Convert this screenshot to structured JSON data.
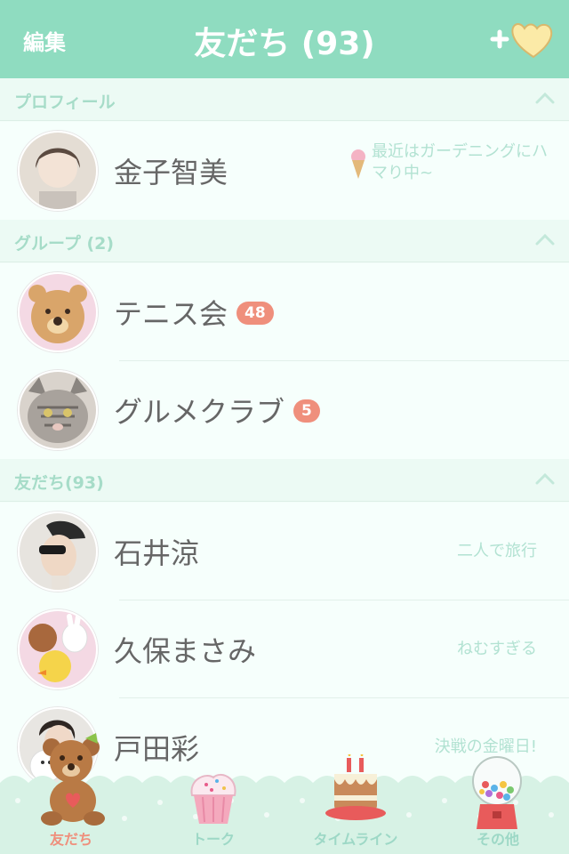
{
  "header": {
    "edit": "編集",
    "title": "友だち (93)"
  },
  "sections": {
    "profile": "プロフィール",
    "groups": "グループ (2)",
    "friends": "友だち(93)"
  },
  "profile": {
    "name": "金子智美",
    "status": "最近はガーデニングにハマり中~"
  },
  "groups": [
    {
      "name": "テニス会",
      "badge": "48"
    },
    {
      "name": "グルメクラブ",
      "badge": "5"
    }
  ],
  "friends": [
    {
      "name": "石井涼",
      "status": "二人で旅行"
    },
    {
      "name": "久保まさみ",
      "status": "ねむすぎる"
    },
    {
      "name": "戸田彩",
      "status": "決戦の金曜日!"
    }
  ],
  "tabs": [
    {
      "label": "友だち",
      "icon": "teddy-bear-icon",
      "active": true
    },
    {
      "label": "トーク",
      "icon": "cupcake-icon",
      "active": false
    },
    {
      "label": "タイムライン",
      "icon": "birthday-cake-icon",
      "active": false
    },
    {
      "label": "その他",
      "icon": "gumball-machine-icon",
      "active": false
    }
  ],
  "colors": {
    "header": "#8fdcc0",
    "badge": "#ef8f7c",
    "accent_text": "#b2e2d2"
  }
}
